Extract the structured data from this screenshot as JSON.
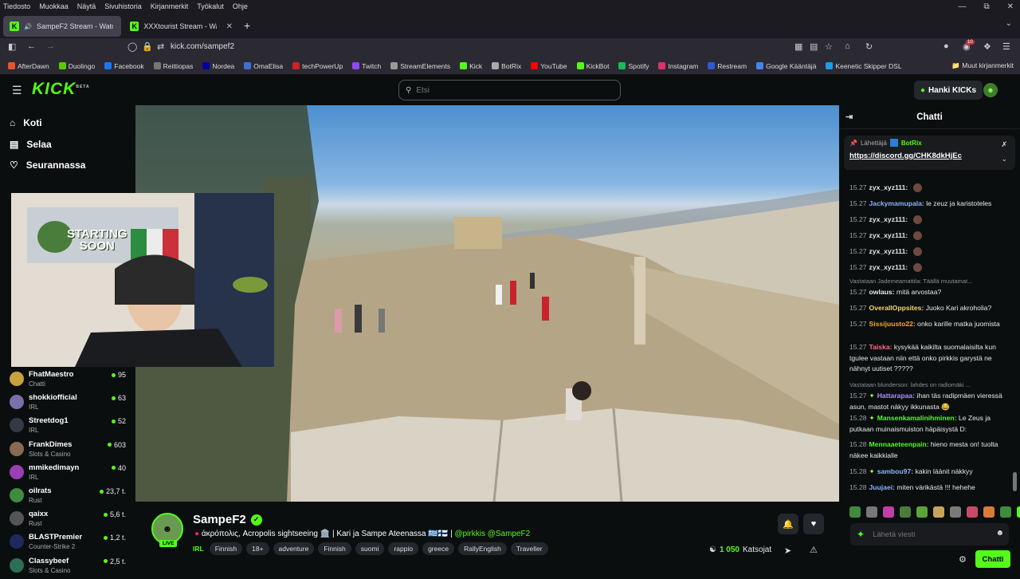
{
  "browser": {
    "menu": [
      "Tiedosto",
      "Muokkaa",
      "Näytä",
      "Sivuhistoria",
      "Kirjanmerkit",
      "Työkalut",
      "Ohje"
    ],
    "tabs": [
      {
        "label": "SampeF2 Stream - Watch L",
        "active": true
      },
      {
        "label": "XXXtourist Stream - Watch",
        "active": false
      }
    ],
    "url": "kick.com/sampef2",
    "bookmarks": [
      {
        "label": "AfterDawn",
        "color": "#e8552d"
      },
      {
        "label": "Duolingo",
        "color": "#58cc02"
      },
      {
        "label": "Facebook",
        "color": "#1877f2"
      },
      {
        "label": "Reittiopas",
        "color": "#777777"
      },
      {
        "label": "Nordea",
        "color": "#0000a0"
      },
      {
        "label": "OmaElisa",
        "color": "#3b6fd8"
      },
      {
        "label": "techPowerUp",
        "color": "#cc2222"
      },
      {
        "label": "Twitch",
        "color": "#9146ff"
      },
      {
        "label": "StreamElements",
        "color": "#999999"
      },
      {
        "label": "Kick",
        "color": "#53fc18"
      },
      {
        "label": "BotRix",
        "color": "#aaaaaa"
      },
      {
        "label": "YouTube",
        "color": "#ff0000"
      },
      {
        "label": "KickBot",
        "color": "#53fc18"
      },
      {
        "label": "Spotify",
        "color": "#1db954"
      },
      {
        "label": "Instagram",
        "color": "#e1306c"
      },
      {
        "label": "Restream",
        "color": "#2a5bd7"
      },
      {
        "label": "Google Kääntäjä",
        "color": "#4285f4"
      },
      {
        "label": "Keenetic Skipper DSL",
        "color": "#1e9be9"
      }
    ],
    "other_bookmarks": "Muut kirjanmerkit",
    "badge_count": "10"
  },
  "kick": {
    "logo": "KICK",
    "logo_sup": "BETA",
    "search_placeholder": "Etsi",
    "kicks_button": "Hanki KICKs",
    "accent": "#53fc18"
  },
  "sidebar": {
    "nav": [
      {
        "label": "Koti",
        "icon": "home-icon"
      },
      {
        "label": "Selaa",
        "icon": "browse-icon"
      },
      {
        "label": "Seurannassa",
        "icon": "heart-icon"
      }
    ],
    "channels": [
      {
        "name": "FhatMaestro",
        "category": "Chatti",
        "viewers": "95",
        "color": "#c9a23e"
      },
      {
        "name": "shokkiofficial",
        "category": "IRL",
        "viewers": "63",
        "color": "#7a6fa8"
      },
      {
        "name": "Streetdog1",
        "category": "IRL",
        "viewers": "52",
        "color": "#333a46"
      },
      {
        "name": "FrankDimes",
        "category": "Slots & Casino",
        "viewers": "603",
        "color": "#8a6a52"
      },
      {
        "name": "mmikedimayn",
        "category": "IRL",
        "viewers": "40",
        "color": "#9c3fb5"
      },
      {
        "name": "oilrats",
        "category": "Rust",
        "viewers": "23,7 t.",
        "color": "#3f8c3f"
      },
      {
        "name": "qaixx",
        "category": "Rust",
        "viewers": "5,6 t.",
        "color": "#555555"
      },
      {
        "name": "BLASTPremier",
        "category": "Counter-Strike 2",
        "viewers": "1,2 t.",
        "color": "#1e2a5e"
      },
      {
        "name": "Classybeef",
        "category": "Slots & Casino",
        "viewers": "2,5 t.",
        "color": "#2d6e55"
      }
    ]
  },
  "webcam": {
    "poster_line1": "STARTING",
    "poster_line2": "SOON"
  },
  "stream": {
    "streamer": "SampeF2",
    "live_label": "LIVE",
    "title_text": "άκρόπολις, Acropolis sightseeing 🏛️ | Kari ja Sampe Ateenassa 🇬🇷🇫🇮 |",
    "title_mentions": "@pirkkis @SampeF2",
    "category": "IRL",
    "tags": [
      "Finnish",
      "18+",
      "adventure",
      "Finnish",
      "suomi",
      "rappio",
      "greece",
      "RallyEnglish",
      "Traveller"
    ],
    "viewer_count": "1 050",
    "viewer_label": "Katsojat"
  },
  "chat": {
    "title": "Chatti",
    "pinned_by_label": "Lähettäjä",
    "pinned_by": "BotRix",
    "pinned_link": "https://discord.gg/CHK8dkHjEc",
    "messages": [
      {
        "kind": "msg",
        "time": "15.27",
        "user": "zyx_xyz111:",
        "color": "#e8e8e8",
        "text": "",
        "badge": false
      },
      {
        "kind": "msg",
        "time": "15.27",
        "user": "Jackymamupala:",
        "color": "#8ab4f8",
        "text": "le zeuz ja karistoteles",
        "badge": false
      },
      {
        "kind": "msg",
        "time": "15.27",
        "user": "zyx_xyz111:",
        "color": "#e8e8e8",
        "text": "",
        "badge": false
      },
      {
        "kind": "msg",
        "time": "15.27",
        "user": "zyx_xyz111:",
        "color": "#e8e8e8",
        "text": "",
        "badge": false
      },
      {
        "kind": "msg",
        "time": "15.27",
        "user": "zyx_xyz111:",
        "color": "#e8e8e8",
        "text": "",
        "badge": false
      },
      {
        "kind": "msg",
        "time": "15.27",
        "user": "zyx_xyz111:",
        "color": "#e8e8e8",
        "text": "",
        "badge": false
      },
      {
        "kind": "reply",
        "text": "Vastataan Jademeamattila: Täällä muutamat..."
      },
      {
        "kind": "msg",
        "time": "15.27",
        "user": "owlaus:",
        "color": "#e8e8e8",
        "text": "mitä arvostaa?",
        "badge": false
      },
      {
        "kind": "msg",
        "time": "15.27",
        "user": "OverallOppsites:",
        "color": "#f5d76e",
        "text": "Juoko Kari akroholia?",
        "badge": false
      },
      {
        "kind": "msg",
        "time": "15.27",
        "user": "Sissijuusto22:",
        "color": "#f5a623",
        "text": "onko karille matka juomista",
        "badge": false
      },
      {
        "kind": "msg",
        "time": "15.27",
        "user": "Taiska:",
        "color": "#ff6b8a",
        "text": "kysykää kaikilta suomalaisilta kun tgulee vastaan niin että onko pirkkis garystä ne nähnyt uutiset ?????",
        "badge": false
      },
      {
        "kind": "reply",
        "text": "Vastataan blunderson: lahdes on radiomäki ..."
      },
      {
        "kind": "msg",
        "time": "15.27",
        "user": "Hattarapaa:",
        "color": "#b28dff",
        "text": "ihan täs radipmäen vieressä asun, mastot näkyy ikkunasta 😂",
        "badge": true
      },
      {
        "kind": "msg",
        "time": "15.28",
        "user": "Mansenkamalinihminen:",
        "color": "#53fc18",
        "text": "Le Zeus ja putkaan muinaismuiston häpäisystä D:",
        "badge": true
      },
      {
        "kind": "msg",
        "time": "15.28",
        "user": "Mennaaeteenpain:",
        "color": "#53fc18",
        "text": "hieno mesta on! tuolta näkee kaikkialle",
        "badge": false
      },
      {
        "kind": "msg",
        "time": "15.28",
        "user": "sambou97:",
        "color": "#8ab4f8",
        "text": "kakin läänit näkkyy",
        "badge": true
      },
      {
        "kind": "msg",
        "time": "15.28",
        "user": "Juujaei:",
        "color": "#8ab4f8",
        "text": "miten värikästä !!! hehehe",
        "badge": false
      }
    ],
    "input_placeholder": "Lähetä viesti",
    "send_label": "Chatti"
  }
}
